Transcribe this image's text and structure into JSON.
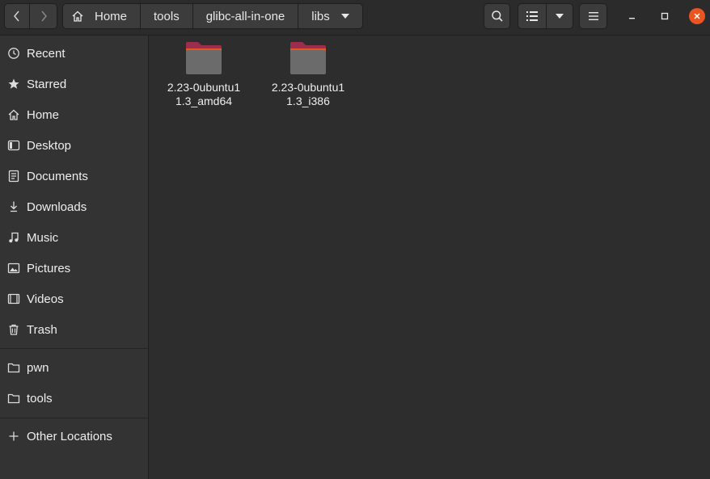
{
  "header": {
    "breadcrumbs": [
      "Home",
      "tools",
      "glibc-all-in-one",
      "libs"
    ]
  },
  "sidebar": {
    "items": [
      {
        "label": "Recent",
        "icon": "clock-icon"
      },
      {
        "label": "Starred",
        "icon": "star-icon"
      },
      {
        "label": "Home",
        "icon": "home-icon"
      },
      {
        "label": "Desktop",
        "icon": "desktop-icon"
      },
      {
        "label": "Documents",
        "icon": "document-icon"
      },
      {
        "label": "Downloads",
        "icon": "download-icon"
      },
      {
        "label": "Music",
        "icon": "music-icon"
      },
      {
        "label": "Pictures",
        "icon": "picture-icon"
      },
      {
        "label": "Videos",
        "icon": "video-icon"
      },
      {
        "label": "Trash",
        "icon": "trash-icon"
      }
    ],
    "bookmarks": [
      {
        "label": "pwn",
        "icon": "folder-icon"
      },
      {
        "label": "tools",
        "icon": "folder-icon"
      }
    ],
    "other_locations": "Other Locations"
  },
  "files": [
    {
      "name": "2.23-0ubuntu11.3_amd64",
      "type": "folder"
    },
    {
      "name": "2.23-0ubuntu11.3_i386",
      "type": "folder"
    }
  ],
  "colors": {
    "accent": "#e95420",
    "folder_body": "#6b6b6b",
    "folder_tab": "#9b2e4e"
  }
}
